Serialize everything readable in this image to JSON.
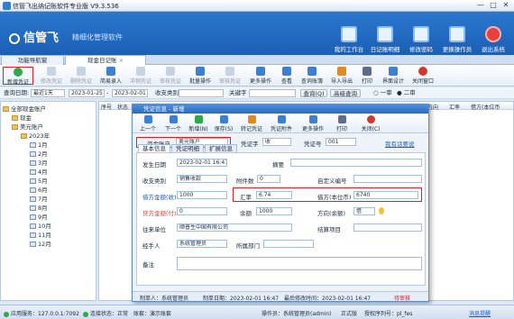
{
  "window": {
    "title": "信管飞出纳记账软件专业版 V9.3.536",
    "minimize": "—",
    "maximize": "□",
    "close": "✕"
  },
  "banner": {
    "logo": "信管飞",
    "slogan": "精细化管理软件",
    "nav": [
      {
        "label": "我的工作台",
        "icon": "desk-icon"
      },
      {
        "label": "日记账明细",
        "icon": "ledger-icon"
      },
      {
        "label": "修改密码",
        "icon": "lock-icon"
      },
      {
        "label": "更换操作员",
        "icon": "user-switch-icon"
      },
      {
        "label": "退出系统",
        "icon": "exit-icon"
      }
    ]
  },
  "tabs": [
    {
      "label": "功能导航窗"
    },
    {
      "label": "现金日记账"
    }
  ],
  "tab_close": "×",
  "toolbar": {
    "buttons": [
      {
        "label": "新增凭证",
        "icon": "add-icon",
        "color": "#2fa84a"
      },
      {
        "label": "修改凭证",
        "icon": "edit-icon",
        "color": "#9bb3d1"
      },
      {
        "label": "删除凭证",
        "icon": "delete-icon",
        "color": "#9bb3d1"
      },
      {
        "label": "简易录入",
        "icon": "quick-entry-icon",
        "color": "#3d7fd1"
      },
      {
        "label": "冲销凭证",
        "icon": "reverse-icon",
        "color": "#9bb3d1"
      },
      {
        "label": "审核凭证",
        "icon": "audit-icon",
        "color": "#9bb3d1"
      },
      {
        "label": "批量操作",
        "icon": "batch-icon",
        "color": "#3d7fd1"
      },
      {
        "label": "审核凭证",
        "icon": "audit2-icon",
        "color": "#9bb3d1"
      },
      {
        "label": "更多操作",
        "icon": "more-icon",
        "color": "#3d7fd1"
      },
      {
        "label": "查看",
        "icon": "view-icon",
        "color": "#3d7fd1"
      },
      {
        "label": "查询账簿",
        "icon": "query-book-icon",
        "color": "#3d7fd1"
      },
      {
        "label": "导入导出",
        "icon": "import-export-icon",
        "color": "#e08a22"
      },
      {
        "label": "打印",
        "icon": "print-icon",
        "color": "#5a6e88"
      },
      {
        "label": "界面设计",
        "icon": "design-icon",
        "color": "#3d7fd1"
      },
      {
        "label": "关闭窗口",
        "icon": "close-window-icon",
        "color": "#d03a2c"
      }
    ]
  },
  "query": {
    "date_label": "查询日期:",
    "period": "最近1天",
    "from": "2023-01-25",
    "to": "2023-02-01",
    "to_sep": "-",
    "category_label": "收支类别",
    "keyword_label": "关键字",
    "query_btn": "查询(Q)",
    "advanced_btn": "高级查询",
    "radio1": "一审",
    "radio2": "二审"
  },
  "tree": [
    {
      "label": "全部现金账户",
      "level": 0
    },
    {
      "label": "现金",
      "level": 1
    },
    {
      "label": "美元账户",
      "level": 1
    },
    {
      "label": "2023年",
      "level": 2
    },
    {
      "label": "1月",
      "level": 3
    },
    {
      "label": "2月",
      "level": 3
    },
    {
      "label": "3月",
      "level": 3
    },
    {
      "label": "4月",
      "level": 3
    },
    {
      "label": "5月",
      "level": 3
    },
    {
      "label": "6月",
      "level": 3
    },
    {
      "label": "7月",
      "level": 3
    },
    {
      "label": "8月",
      "level": 3
    },
    {
      "label": "9月",
      "level": 3
    },
    {
      "label": "10月",
      "level": 3
    },
    {
      "label": "11月",
      "level": 3
    },
    {
      "label": "12月",
      "level": 3
    }
  ],
  "grid_headers": [
    "序号",
    "状态",
    "方向",
    "汇率",
    "借方(本位币"
  ],
  "dialog": {
    "title": "凭证信息 - 新增",
    "toolbar": [
      {
        "label": "上一个",
        "icon": "prev-icon"
      },
      {
        "label": "下一个",
        "icon": "next-icon"
      },
      {
        "label": "新增(N)",
        "icon": "new-icon"
      },
      {
        "label": "保存(S)",
        "icon": "save-icon"
      },
      {
        "label": "转记凭证",
        "icon": "transfer-icon"
      },
      {
        "label": "凭证附件",
        "icon": "attachment-icon"
      },
      {
        "label": "更多操作",
        "icon": "more-ops-icon"
      },
      {
        "label": "打印",
        "icon": "print-icon"
      },
      {
        "label": "关闭(C)",
        "icon": "close-icon"
      }
    ],
    "account_label": "资金账户",
    "account_value": "美元账户",
    "voucher_word_label": "凭证字",
    "voucher_word": "收",
    "voucher_no_label": "凭证号",
    "voucher_no": "001",
    "link_label": "我有话要说",
    "tabs": [
      "基本信息",
      "凭证明细",
      "扩展信息"
    ],
    "fields": {
      "date_label": "发生日期",
      "date": "2023-02-01 16:47",
      "summary_label": "摘要",
      "summary": "",
      "category_label": "收支类别",
      "category": "销售收款",
      "attachments_label": "附件数",
      "attachments": "0",
      "custom_no_label": "自定义编号",
      "custom_no": "",
      "debit_label": "借方金额(收)",
      "debit": "1000",
      "rate_label": "汇率",
      "rate": "6.74",
      "base_debit_label": "借方(本位币)",
      "base_debit": "6740",
      "credit_label": "贷方金额(付)",
      "credit": "0",
      "balance_label": "余额",
      "balance": "1000",
      "direction_label": "方向(余额)",
      "direction": "借",
      "unit_label": "往来单位",
      "unit": "顺普生中国有限公司",
      "settle_label": "结算项目",
      "settle": "",
      "handler_label": "经手人",
      "handler": "系统管理员",
      "dept_label": "所属部门",
      "dept": "",
      "remark_label": "备注",
      "remark": ""
    },
    "footer": {
      "maker_label": "制单人：",
      "maker": "系统管理员",
      "make_time_label": "制单日期：",
      "make_time": "2023-02-01 16:47",
      "last_modified_label": "最后修改时间：",
      "last_modified": "2023-02-01 16:47",
      "audit": "待审核"
    }
  },
  "status": {
    "app_label": "应用服务：127.0.0.1:7092",
    "conn_label": "连接状态：正常",
    "account_label": "账套：演示账套",
    "operator_label": "操作员：系统管理员(admin)",
    "edition": "正式版",
    "license": "授权序列号：pl_fes",
    "update_link": "消息提醒"
  }
}
